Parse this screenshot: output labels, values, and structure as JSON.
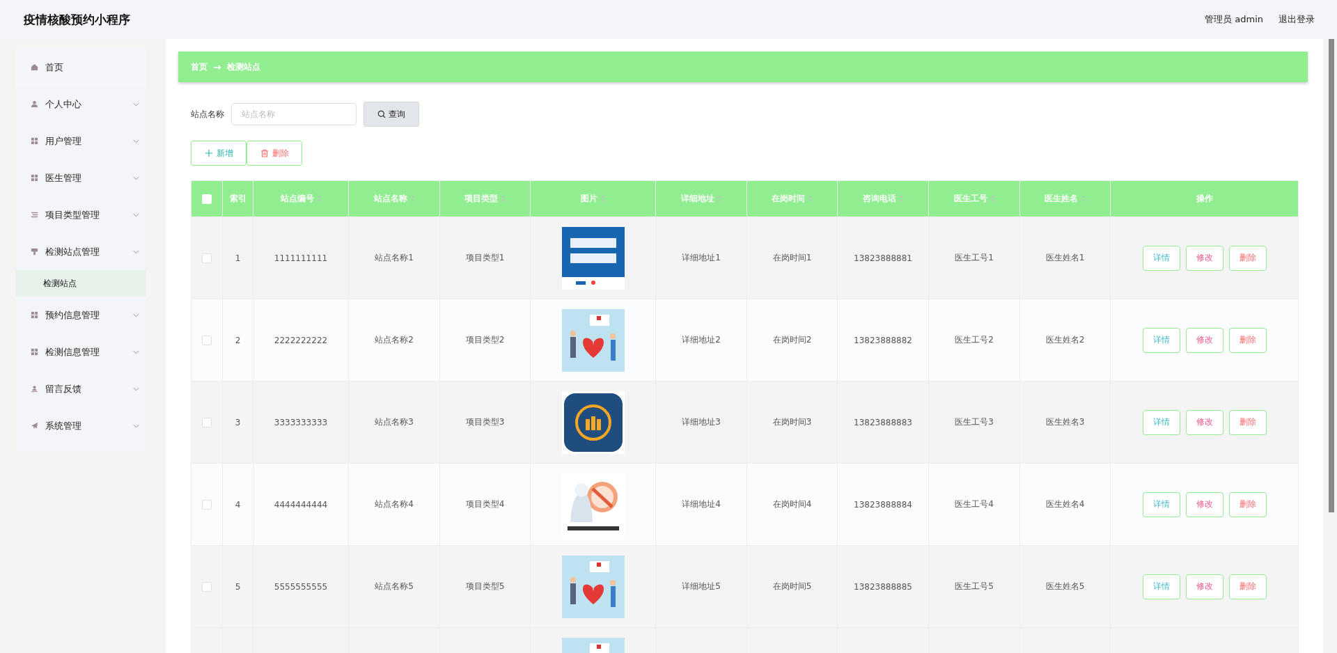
{
  "header": {
    "title": "疫情核酸预约小程序",
    "user": "管理员 admin",
    "logout": "退出登录"
  },
  "sidebar": {
    "items": [
      {
        "label": "首页",
        "expandable": false
      },
      {
        "label": "个人中心",
        "expandable": true
      },
      {
        "label": "用户管理",
        "expandable": true
      },
      {
        "label": "医生管理",
        "expandable": true
      },
      {
        "label": "项目类型管理",
        "expandable": true
      },
      {
        "label": "检测站点管理",
        "expandable": true,
        "children": [
          {
            "label": "检测站点",
            "selected": true
          }
        ]
      },
      {
        "label": "预约信息管理",
        "expandable": true
      },
      {
        "label": "检测信息管理",
        "expandable": true
      },
      {
        "label": "留言反馈",
        "expandable": true
      },
      {
        "label": "系统管理",
        "expandable": true
      }
    ]
  },
  "breadcrumb": {
    "home": "首页",
    "arrow": "→",
    "current": "检测站点"
  },
  "search": {
    "label": "站点名称",
    "placeholder": "站点名称",
    "button": "查询"
  },
  "actions": [
    {
      "label": "新增",
      "kind": "add"
    },
    {
      "label": "删除",
      "kind": "delete"
    }
  ],
  "table": {
    "header_checked": false,
    "columns": [
      {
        "label": "索引",
        "sortable": false
      },
      {
        "label": "站点编号",
        "sortable": true
      },
      {
        "label": "站点名称",
        "sortable": true
      },
      {
        "label": "项目类型",
        "sortable": true
      },
      {
        "label": "图片",
        "sortable": true
      },
      {
        "label": "详细地址",
        "sortable": true
      },
      {
        "label": "在岗时间",
        "sortable": true
      },
      {
        "label": "咨询电话",
        "sortable": true
      },
      {
        "label": "医生工号",
        "sortable": true
      },
      {
        "label": "医生姓名",
        "sortable": true
      },
      {
        "label": "操作",
        "sortable": false
      }
    ],
    "rows": [
      {
        "checked": false,
        "index": "1",
        "code": "1111111111",
        "name": "站点名称1",
        "type": "项目类型1",
        "address": "详细地址1",
        "hours": "在岗时间1",
        "phone": "13823888881",
        "doctor_id": "医生工号1",
        "doctor_name": "医生姓名1",
        "buttons": [
          {
            "label": "详情",
            "kind": "detail"
          },
          {
            "label": "修改",
            "kind": "edit"
          },
          {
            "label": "删除",
            "kind": "delete"
          }
        ]
      },
      {
        "checked": false,
        "index": "2",
        "code": "2222222222",
        "name": "站点名称2",
        "type": "项目类型2",
        "address": "详细地址2",
        "hours": "在岗时间2",
        "phone": "13823888882",
        "doctor_id": "医生工号2",
        "doctor_name": "医生姓名2",
        "buttons": [
          {
            "label": "详情",
            "kind": "detail"
          },
          {
            "label": "修改",
            "kind": "edit"
          },
          {
            "label": "删除",
            "kind": "delete"
          }
        ]
      },
      {
        "checked": false,
        "index": "3",
        "code": "3333333333",
        "name": "站点名称3",
        "type": "项目类型3",
        "address": "详细地址3",
        "hours": "在岗时间3",
        "phone": "13823888883",
        "doctor_id": "医生工号3",
        "doctor_name": "医生姓名3",
        "buttons": [
          {
            "label": "详情",
            "kind": "detail"
          },
          {
            "label": "修改",
            "kind": "edit"
          },
          {
            "label": "删除",
            "kind": "delete"
          }
        ]
      },
      {
        "checked": false,
        "index": "4",
        "code": "4444444444",
        "name": "站点名称4",
        "type": "项目类型4",
        "address": "详细地址4",
        "hours": "在岗时间4",
        "phone": "13823888884",
        "doctor_id": "医生工号4",
        "doctor_name": "医生姓名4",
        "buttons": [
          {
            "label": "详情",
            "kind": "detail"
          },
          {
            "label": "修改",
            "kind": "edit"
          },
          {
            "label": "删除",
            "kind": "delete"
          }
        ]
      },
      {
        "checked": false,
        "index": "5",
        "code": "5555555555",
        "name": "站点名称5",
        "type": "项目类型5",
        "address": "详细地址5",
        "hours": "在岗时间5",
        "phone": "13823888885",
        "doctor_id": "医生工号5",
        "doctor_name": "医生姓名5",
        "buttons": [
          {
            "label": "详情",
            "kind": "detail"
          },
          {
            "label": "修改",
            "kind": "edit"
          },
          {
            "label": "删除",
            "kind": "delete"
          }
        ]
      }
    ]
  }
}
